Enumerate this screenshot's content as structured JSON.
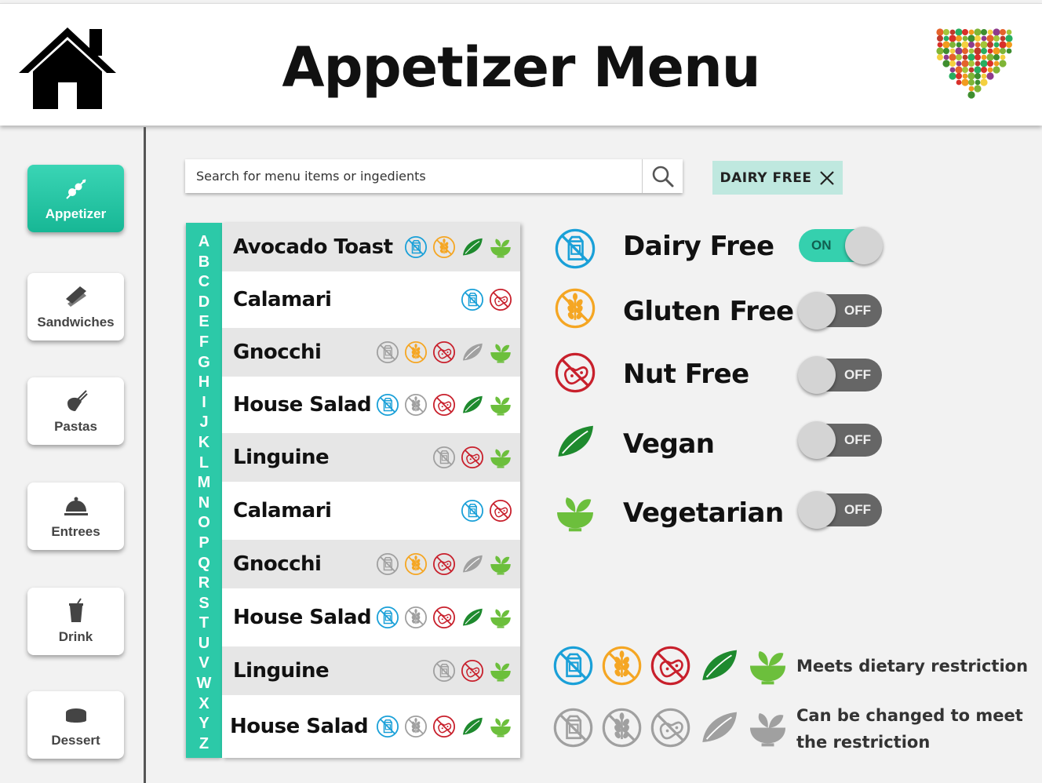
{
  "header": {
    "title": "Appetizer Menu",
    "home_icon": "home-icon",
    "logo_icon": "fruit-heart-logo"
  },
  "nav": [
    {
      "label": "Appetizer",
      "icon": "skewer-icon",
      "active": true
    },
    {
      "label": "Sandwiches",
      "icon": "sandwich-icon",
      "active": false
    },
    {
      "label": "Pastas",
      "icon": "pasta-icon",
      "active": false
    },
    {
      "label": "Entrees",
      "icon": "cloche-icon",
      "active": false
    },
    {
      "label": "Drink",
      "icon": "cup-icon",
      "active": false
    },
    {
      "label": "Dessert",
      "icon": "cake-icon",
      "active": false
    }
  ],
  "search": {
    "placeholder": "Search for menu items or ingedients",
    "value": ""
  },
  "active_filter_chip": {
    "label": "DAIRY FREE"
  },
  "alphabet": [
    "A",
    "B",
    "C",
    "D",
    "E",
    "F",
    "G",
    "H",
    "I",
    "J",
    "K",
    "L",
    "M",
    "N",
    "O",
    "P",
    "Q",
    "R",
    "S",
    "T",
    "U",
    "V",
    "W",
    "X",
    "Y",
    "Z"
  ],
  "menu_items": [
    {
      "name": "Avocado Toast",
      "tags": [
        "dairy:meets",
        "gluten:meets",
        "vegan:meets",
        "vegetarian:meets"
      ]
    },
    {
      "name": "Calamari",
      "tags": [
        "dairy:meets",
        "nut:meets"
      ]
    },
    {
      "name": "Gnocchi",
      "tags": [
        "dairy:changeable",
        "gluten:meets",
        "nut:meets",
        "vegan:changeable",
        "vegetarian:meets"
      ]
    },
    {
      "name": "House Salad",
      "tags": [
        "dairy:meets",
        "gluten:changeable",
        "nut:meets",
        "vegan:meets",
        "vegetarian:meets"
      ]
    },
    {
      "name": "Linguine",
      "tags": [
        "dairy:changeable",
        "nut:meets",
        "vegetarian:meets"
      ]
    },
    {
      "name": "Calamari",
      "tags": [
        "dairy:meets",
        "nut:meets"
      ]
    },
    {
      "name": "Gnocchi",
      "tags": [
        "dairy:changeable",
        "gluten:meets",
        "nut:meets",
        "vegan:changeable",
        "vegetarian:meets"
      ]
    },
    {
      "name": "House Salad",
      "tags": [
        "dairy:meets",
        "gluten:changeable",
        "nut:meets",
        "vegan:meets",
        "vegetarian:meets"
      ]
    },
    {
      "name": "Linguine",
      "tags": [
        "dairy:changeable",
        "nut:meets",
        "vegetarian:meets"
      ]
    },
    {
      "name": "House Salad",
      "tags": [
        "dairy:meets",
        "gluten:changeable",
        "nut:meets",
        "vegan:meets",
        "vegetarian:meets"
      ]
    }
  ],
  "filters": [
    {
      "key": "dairy",
      "label": "Dairy Free",
      "state": "ON",
      "on": true
    },
    {
      "key": "gluten",
      "label": "Gluten Free",
      "state": "OFF",
      "on": false
    },
    {
      "key": "nut",
      "label": "Nut Free",
      "state": "OFF",
      "on": false
    },
    {
      "key": "vegan",
      "label": "Vegan",
      "state": "OFF",
      "on": false
    },
    {
      "key": "vegetarian",
      "label": "Vegetarian",
      "state": "OFF",
      "on": false
    }
  ],
  "legend": {
    "meets": "Meets dietary restriction",
    "changeable_line1": "Can be changed to meet",
    "changeable_line2": "the restriction"
  },
  "colors": {
    "accent": "#2cc9a8",
    "dairy": "#1aa0d8",
    "gluten": "#f5a623",
    "nut": "#c8202c",
    "vegan": "#1e8a2e",
    "vegetarian": "#6cbf3c",
    "changeable": "#a0a0a0"
  }
}
